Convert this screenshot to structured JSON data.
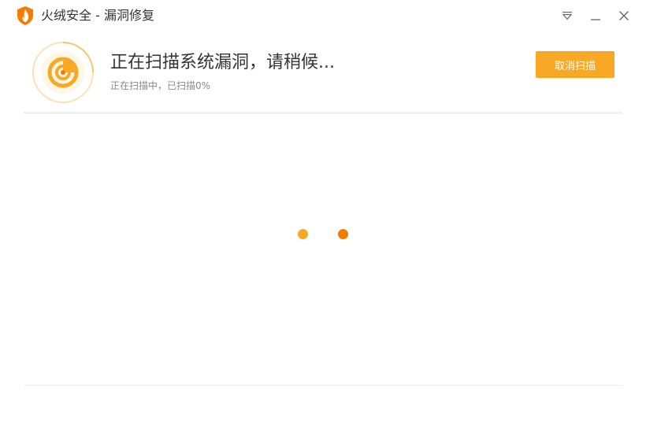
{
  "window": {
    "title": "火绒安全 - 漏洞修复",
    "menu_icon": "menu-triangle-icon",
    "minimize_icon": "minimize-icon",
    "close_icon": "close-icon"
  },
  "header": {
    "headline": "正在扫描系统漏洞，请稍候...",
    "status": "正在扫描中，已扫描0%",
    "progress_percent": 0,
    "cancel_label": "取消扫描",
    "scan_icon": "scan-radar-icon"
  },
  "loading": {
    "dot_icon": "loading-dot-icon"
  },
  "colors": {
    "accent": "#f9a825",
    "accent_dark": "#f57c00",
    "ring_light": "#fde3b3"
  }
}
